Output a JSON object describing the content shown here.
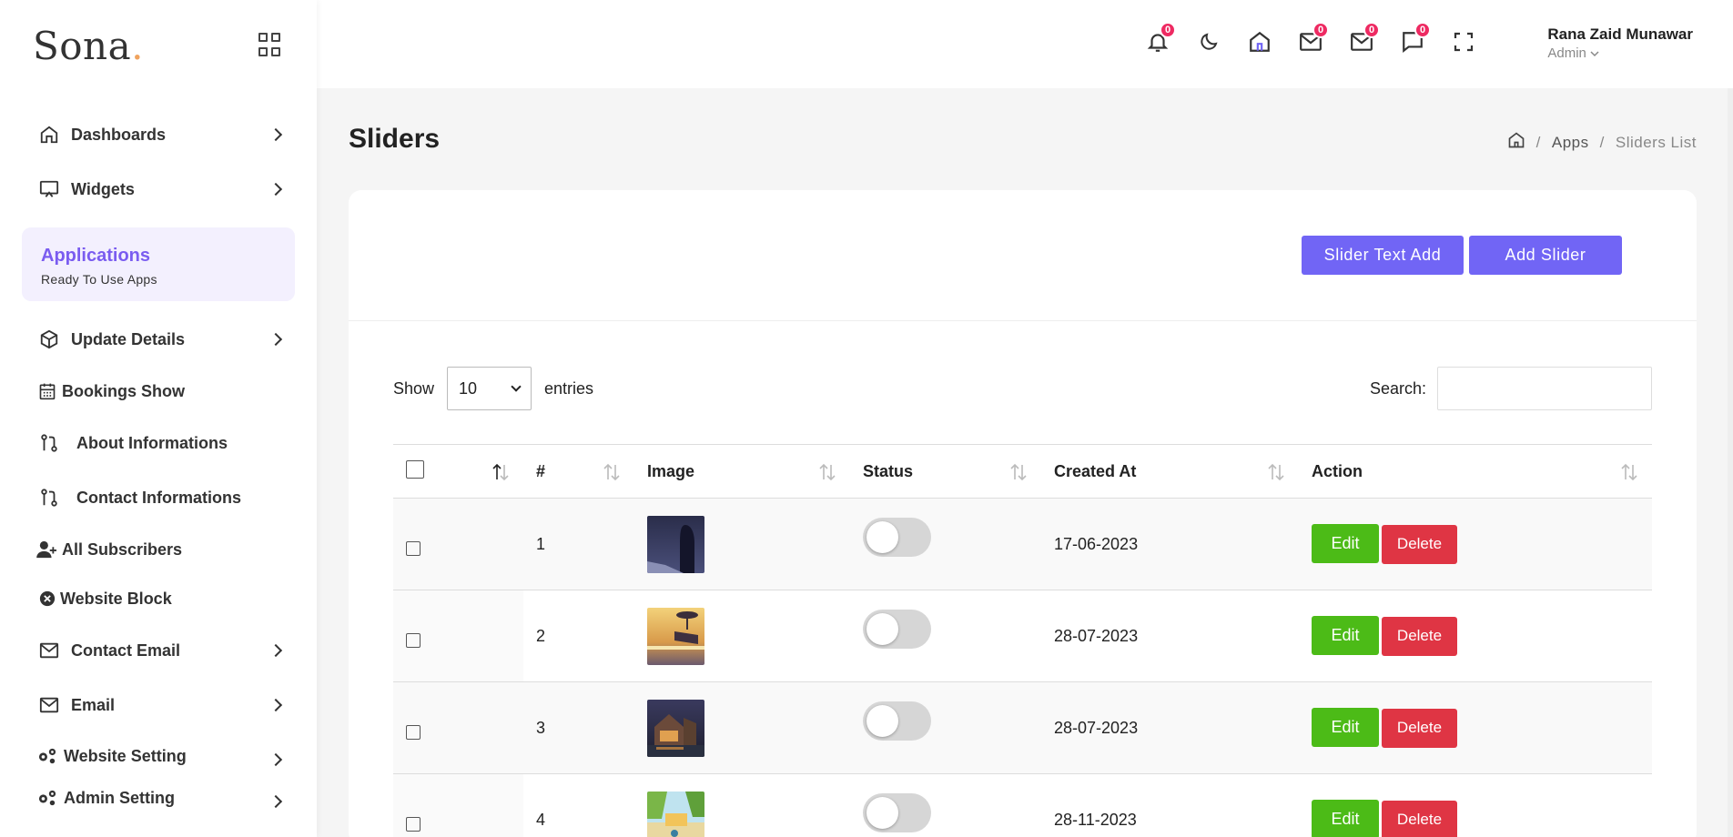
{
  "brand": {
    "name": "Sona",
    "dot": "."
  },
  "sidebar": {
    "items_top": [
      {
        "label": "Dashboards",
        "icon": "home-icon",
        "chevron": true
      },
      {
        "label": "Widgets",
        "icon": "monitor-icon",
        "chevron": true
      }
    ],
    "apps": {
      "title": "Applications",
      "subtitle": "Ready To Use Apps"
    },
    "items": [
      {
        "label": "Update Details",
        "icon": "box-icon",
        "chevron": true
      },
      {
        "label": "Bookings Show",
        "icon": "calendar-icon",
        "chevron": false
      },
      {
        "label": "About Informations",
        "icon": "git-compare-icon",
        "chevron": false
      },
      {
        "label": "Contact Informations",
        "icon": "git-compare-icon",
        "chevron": false
      },
      {
        "label": "All Subscribers",
        "icon": "user-plus-icon",
        "chevron": false
      },
      {
        "label": "Website Block",
        "icon": "times-circle-icon",
        "chevron": false
      },
      {
        "label": "Contact Email",
        "icon": "mail-icon",
        "chevron": true
      },
      {
        "label": "Email",
        "icon": "mail-icon",
        "chevron": true
      },
      {
        "label": "Website Setting",
        "icon": "cogs-icon",
        "chevron": true
      },
      {
        "label": "Admin Setting",
        "icon": "cogs-icon",
        "chevron": true
      }
    ]
  },
  "header": {
    "icons": [
      {
        "name": "bell-icon",
        "badge": "0"
      },
      {
        "name": "moon-icon",
        "badge": null
      },
      {
        "name": "home-icon",
        "badge": null
      },
      {
        "name": "mail-icon",
        "badge": "0"
      },
      {
        "name": "mail-icon",
        "badge": "0"
      },
      {
        "name": "message-icon",
        "badge": "0"
      },
      {
        "name": "fullscreen-icon",
        "badge": null
      }
    ],
    "user": {
      "name": "Rana Zaid Munawar",
      "role": "Admin"
    }
  },
  "page": {
    "title": "Sliders",
    "breadcrumb": {
      "apps": "Apps",
      "sep": "/",
      "current": "Sliders List"
    }
  },
  "actions": {
    "slider_text_add": "Slider Text Add",
    "add_slider": "Add Slider"
  },
  "datatable": {
    "show_label": "Show",
    "entries_value": "10",
    "entries_label": "entries",
    "search_label": "Search:",
    "search_value": ""
  },
  "table": {
    "columns": [
      "#",
      "Image",
      "Status",
      "Created At",
      "Action"
    ],
    "rows": [
      {
        "num": "1",
        "created": "17-06-2023",
        "status_on": false
      },
      {
        "num": "2",
        "created": "28-07-2023",
        "status_on": false
      },
      {
        "num": "3",
        "created": "28-07-2023",
        "status_on": false
      },
      {
        "num": "4",
        "created": "28-11-2023",
        "status_on": false
      }
    ],
    "edit_label": "Edit",
    "delete_label": "Delete"
  },
  "colors": {
    "accent": "#7165f5",
    "edit": "#4cbb17",
    "delete": "#df3544",
    "badge": "#ee2a62"
  }
}
